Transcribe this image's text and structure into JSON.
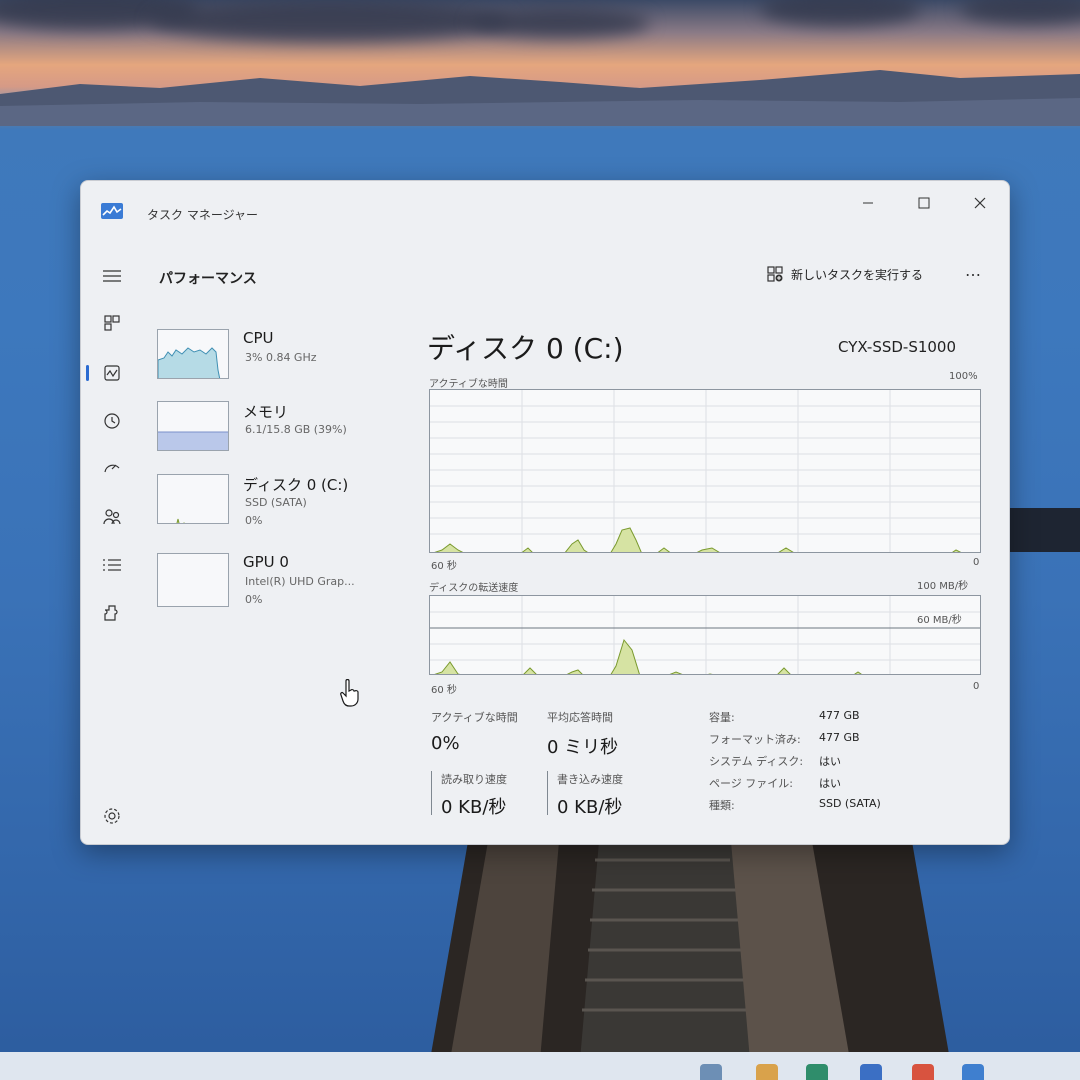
{
  "window": {
    "title": "タスク マネージャー",
    "section_title": "パフォーマンス",
    "run_new_task_label": "新しいタスクを実行する",
    "more_label": "…"
  },
  "nav": {
    "items": [
      {
        "name": "menu-icon",
        "glyph": "≡"
      },
      {
        "name": "processes-icon"
      },
      {
        "name": "performance-icon",
        "active": true
      },
      {
        "name": "app-history-icon"
      },
      {
        "name": "startup-apps-icon"
      },
      {
        "name": "users-icon"
      },
      {
        "name": "details-icon"
      },
      {
        "name": "services-icon"
      },
      {
        "name": "settings-icon"
      }
    ]
  },
  "resources": [
    {
      "name": "CPU",
      "sub1": "3%  0.84 GHz",
      "sub2": ""
    },
    {
      "name": "メモリ",
      "sub1": "6.1/15.8 GB (39%)",
      "sub2": ""
    },
    {
      "name": "ディスク 0 (C:)",
      "sub1": "SSD (SATA)",
      "sub2": "0%"
    },
    {
      "name": "GPU 0",
      "sub1": "Intel(R) UHD Grap...",
      "sub2": "0%"
    }
  ],
  "detail": {
    "title": "ディスク 0 (C:)",
    "device": "CYX-SSD-S1000",
    "graph1": {
      "label": "アクティブな時間",
      "max_label": "100%",
      "left_bottom": "60 秒",
      "right_bottom": "0"
    },
    "graph2": {
      "label": "ディスクの転送速度",
      "max_label": "100 MB/秒",
      "mid_label": "60 MB/秒",
      "left_bottom": "60 秒",
      "right_bottom": "0"
    },
    "stats": {
      "active_time_label": "アクティブな時間",
      "active_time_value": "0%",
      "avg_response_label": "平均応答時間",
      "avg_response_value": "0 ミリ秒",
      "read_speed_label": "読み取り速度",
      "read_speed_value": "0 KB/秒",
      "write_speed_label": "書き込み速度",
      "write_speed_value": "0 KB/秒"
    },
    "properties": [
      {
        "key": "容量:",
        "value": "477 GB"
      },
      {
        "key": "フォーマット済み:",
        "value": "477 GB"
      },
      {
        "key": "システム ディスク:",
        "value": "はい"
      },
      {
        "key": "ページ ファイル:",
        "value": "はい"
      },
      {
        "key": "種類:",
        "value": "SSD (SATA)"
      }
    ]
  },
  "colors": {
    "disk_line": "#7a9a2e",
    "disk_fill": "#d6e3a3",
    "cpu_line": "#3f8fb3",
    "cpu_fill": "#b6dbe6",
    "mem_line": "#7b8fc9",
    "mem_fill": "#bac8ea",
    "accent": "#2b6bd1"
  }
}
